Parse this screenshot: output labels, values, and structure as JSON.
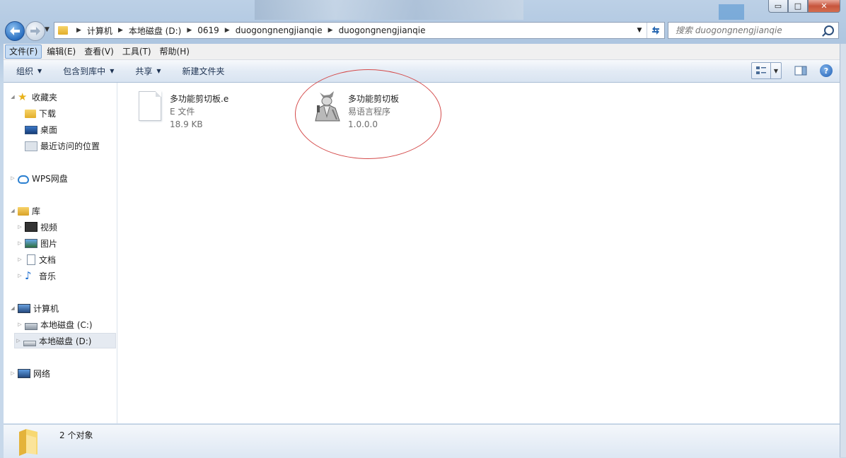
{
  "window": {
    "caption_buttons": {
      "minimize": "▭",
      "maximize": "□",
      "close": "✕"
    }
  },
  "address": {
    "breadcrumbs": [
      "计算机",
      "本地磁盘 (D:)",
      "0619",
      "duogongnengjianqie",
      "duogongnengjianqie"
    ]
  },
  "search": {
    "placeholder": "搜索 duogongnengjianqie"
  },
  "menubar": {
    "items": [
      "文件(F)",
      "编辑(E)",
      "查看(V)",
      "工具(T)",
      "帮助(H)"
    ]
  },
  "toolbar": {
    "organize": "组织",
    "include_in_library": "包含到库中",
    "share": "共享",
    "new_folder": "新建文件夹",
    "help_glyph": "?"
  },
  "navigation": {
    "favorites": {
      "label": "收藏夹",
      "items": [
        "下载",
        "桌面",
        "最近访问的位置"
      ]
    },
    "wps": {
      "label": "WPS网盘"
    },
    "libraries": {
      "label": "库",
      "items": [
        "视频",
        "图片",
        "文档",
        "音乐"
      ]
    },
    "computer": {
      "label": "计算机",
      "items": [
        "本地磁盘 (C:)",
        "本地磁盘 (D:)"
      ]
    },
    "network": {
      "label": "网络"
    }
  },
  "files": [
    {
      "name": "多功能剪切板.e",
      "type": "E 文件",
      "size": "18.9 KB",
      "icon": "generic-file-icon"
    },
    {
      "name": "多功能剪切板",
      "type": "易语言程序",
      "version": "1.0.0.0",
      "icon": "app-icon"
    }
  ],
  "status": {
    "item_count": "2 个对象"
  },
  "colors": {
    "annotation": "#d44a4a",
    "accent": "#2a6fc1"
  }
}
